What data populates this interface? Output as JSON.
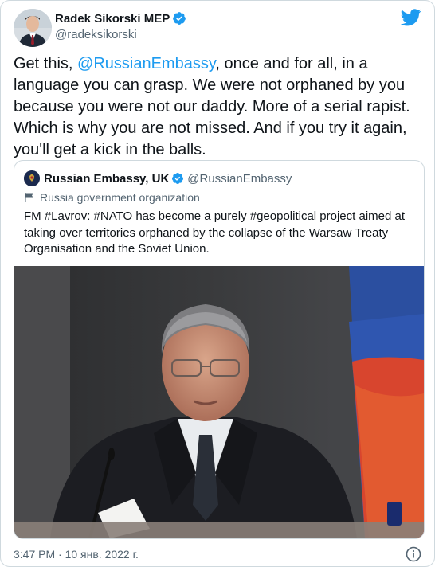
{
  "author": {
    "display_name": "Radek Sikorski MEP",
    "handle": "@radeksikorski",
    "verified": true,
    "avatar": "profile-photo"
  },
  "brand": {
    "icon": "twitter-bird-icon",
    "color": "#1d9bf0"
  },
  "tweet": {
    "text_before": "Get this, ",
    "mention": "@RussianEmbassy",
    "text_after": ", once and for all, in a language you can grasp. We were not orphaned by you because you were not our daddy. More of a serial rapist. Which is why you are not missed. And if you try it again, you'll get a kick in the balls."
  },
  "quoted": {
    "display_name": "Russian Embassy, UK",
    "handle": "@RussianEmbassy",
    "verified": true,
    "label": "Russia government organization",
    "label_icon": "flag-icon",
    "text": "FM #Lavrov: #NATO has become a purely #geopolitical project aimed at taking over territories orphaned by the collapse of the Warsaw Treaty Organisation and the Soviet Union.",
    "photo": "photo of a man in a suit at a podium in front of a Russian flag"
  },
  "footer": {
    "timestamp": "3:47 PM · 10 янв. 2022 г.",
    "info_icon": "info-icon"
  },
  "colors": {
    "accent": "#1d9bf0",
    "text": "#0f1419",
    "secondary_text": "#536471",
    "border": "#cfd9de"
  }
}
